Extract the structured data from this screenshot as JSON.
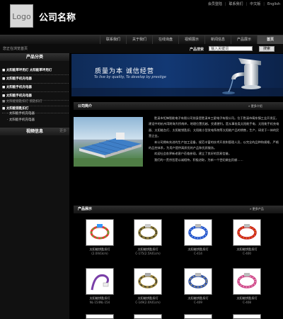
{
  "header": {
    "logo_text": "Logo",
    "company_name": "公司名称",
    "top_links": [
      "会员登陆",
      "|",
      "联系我们",
      "|",
      "中文版",
      "|",
      "English"
    ]
  },
  "nav": {
    "items": [
      {
        "label": "联系我们",
        "active": false
      },
      {
        "label": "关于我们",
        "active": false
      },
      {
        "label": "在线询盘",
        "active": false
      },
      {
        "label": "视频展示",
        "active": false
      },
      {
        "label": "新闻信息",
        "active": false
      },
      {
        "label": "产品展示",
        "active": false
      },
      {
        "label": "首页",
        "active": true
      }
    ]
  },
  "subbar": {
    "welcome": "您正在浏览首页",
    "search_label": "产品搜索",
    "search_placeholder": "输入关键词",
    "search_button": "搜索"
  },
  "sidebar": {
    "category_title": "产品分类",
    "categories": [
      {
        "label": "太阳能草坪用灯 太阳能草坪用灯",
        "type": "main"
      },
      {
        "label": "太阳能手机充电器",
        "type": "main"
      },
      {
        "label": "太阳能手机充电器",
        "type": "main"
      },
      {
        "label": "太阳能手机充电器",
        "type": "main"
      },
      {
        "label": "太阳能锁匙扣灯 锁匙扣灯",
        "type": "grey"
      },
      {
        "label": "太阳能锁匙扣灯",
        "type": "main"
      }
    ],
    "subitems": [
      "太阳能手机充电器",
      "太阳能手机充电器"
    ],
    "video_title": "视频信息",
    "video_more": "更多"
  },
  "banner": {
    "title": "质量为本   诚信经营",
    "subtitle": "To live by quality, To develop by prestige"
  },
  "intro": {
    "title": "公司简介",
    "more": "» 更多介绍",
    "paragraphs": [
      "胜溪市钜锋智能电子有限公司前身是胜溪市三星电子有限公司。位于胜溪市庵东镇工业开发区，建设中的杭州湾跨海大桥南岸，地理位置优越，交通便利。是从事各类太阳能手电、太阳能手机充电器、太阳能台灯、太阳能钥匙扣、太阳能小型发电系统等太阳能产品的销售，生产，研发于一体的民营企业。",
      "本公司拥有先进的生产加工设备，规范丰富的技术开发和管理人员，以完全的品种和规格，严格的品控体系，为用户提供高质优的产品和优质服务。",
      "欢迎社会各界新老客户莅临参观，建立了良好的贸易信誉。",
      "我们的一贯宗旨是以诚相待，积极进取，为新一个世纪做出贡献……"
    ]
  },
  "products": {
    "title": "产品展示",
    "more": "» 更多产品",
    "items": [
      {
        "name": "太阳能钥匙扣灯",
        "code": "(2.0X43cm)",
        "style": "rainbow"
      },
      {
        "name": "太阳能钥匙扣灯",
        "code": "C-175(2.5X41cm)",
        "style": "camo"
      },
      {
        "name": "太阳能钥匙扣灯",
        "code": "C-414",
        "style": "blue"
      },
      {
        "name": "太阳能钥匙扣灯",
        "code": "C-400",
        "style": "red"
      },
      {
        "name": "太阳能钥匙扣灯",
        "code": "NL-154NL-154",
        "style": "purple"
      },
      {
        "name": "太阳能钥匙扣灯",
        "code": "C-149(2.0X41cm)",
        "style": "camo2"
      },
      {
        "name": "太阳能钥匙扣灯",
        "code": "C-409",
        "style": "blue2"
      },
      {
        "name": "太阳能钥匙扣灯",
        "code": "C-408",
        "style": "pink"
      }
    ]
  },
  "colors": {
    "background": "#000000",
    "banner": "#123874",
    "active_nav": "#444444"
  }
}
